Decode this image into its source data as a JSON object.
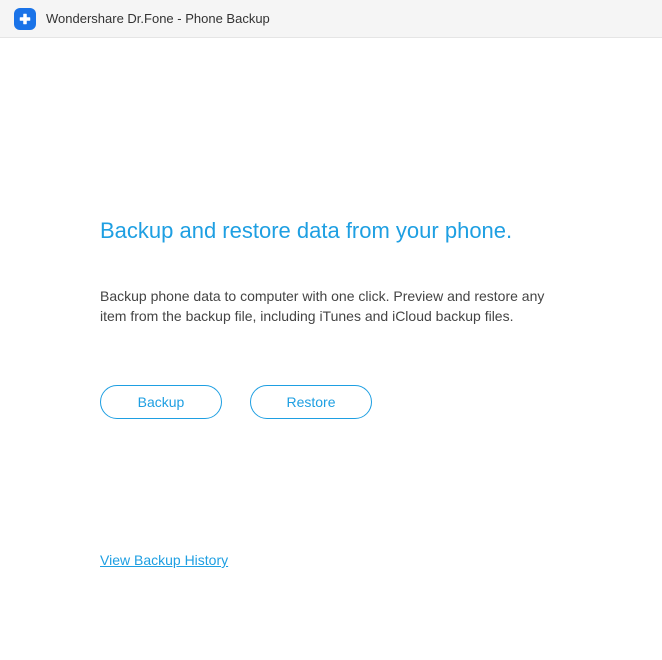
{
  "titlebar": {
    "title": "Wondershare Dr.Fone - Phone Backup"
  },
  "main": {
    "headline": "Backup and restore data from your phone.",
    "description": "Backup phone data to computer with one click. Preview and restore any item from the backup file, including iTunes and iCloud backup files.",
    "backup_button": "Backup",
    "restore_button": "Restore",
    "history_link": "View Backup History"
  },
  "colors": {
    "accent": "#1e9fe2",
    "brand": "#1a73e8"
  }
}
